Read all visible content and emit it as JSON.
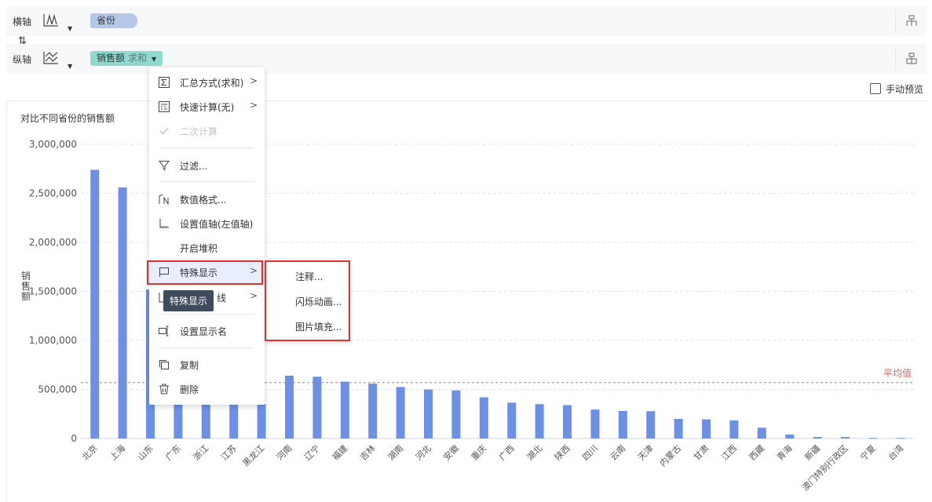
{
  "axes": {
    "x": {
      "label": "横轴",
      "field": "省份"
    },
    "y": {
      "label": "纵轴",
      "field": "销售额",
      "aggregation": "求和"
    }
  },
  "manual_preview": {
    "label": "手动预览"
  },
  "context_menu": {
    "items": [
      {
        "label": "汇总方式(求和)",
        "icon": "sigma-icon",
        "submenu": true
      },
      {
        "label": "快速计算(无)",
        "icon": "calculator-icon",
        "submenu": true
      },
      {
        "label": "二次计算",
        "icon": "check-icon",
        "disabled": true
      },
      {
        "label": "过滤...",
        "icon": "filter-icon"
      },
      {
        "label": "数值格式...",
        "icon": "number-format-icon"
      },
      {
        "label": "设置值轴(左值轴)",
        "icon": "value-axis-icon"
      },
      {
        "label": "开启堆积"
      },
      {
        "label": "特殊显示",
        "icon": "flag-icon",
        "submenu": true,
        "highlighted": true
      },
      {
        "label": "线",
        "icon": "line-icon",
        "submenu": true
      },
      {
        "label": "设置显示名",
        "icon": "rename-icon"
      },
      {
        "label": "复制",
        "icon": "copy-icon"
      },
      {
        "label": "删除",
        "icon": "trash-icon"
      }
    ],
    "tooltip": "特殊显示",
    "submenu": [
      "注释...",
      "闪烁动画...",
      "图片填充..."
    ]
  },
  "chart_data": {
    "type": "bar",
    "title": "对比不同省份的销售额",
    "ylabel": "销售额",
    "xlabel": "",
    "ylim": [
      0,
      3000000
    ],
    "yticks": [
      "3,000,000",
      "2,500,000",
      "2,000,000",
      "1,500,000",
      "1,000,000",
      "500,000",
      "0"
    ],
    "ytick_values": [
      3000000,
      2500000,
      2000000,
      1500000,
      1000000,
      500000,
      0
    ],
    "categories": [
      "北京",
      "上海",
      "山东",
      "广东",
      "浙江",
      "江苏",
      "黑龙江",
      "河南",
      "辽宁",
      "福建",
      "吉林",
      "湖南",
      "河北",
      "安徽",
      "重庆",
      "广西",
      "湖北",
      "陕西",
      "四川",
      "云南",
      "天津",
      "内蒙古",
      "甘肃",
      "江西",
      "西藏",
      "青海",
      "新疆",
      "澳门特别行政区",
      "宁夏",
      "台湾"
    ],
    "values": [
      2740000,
      2560000,
      1520000,
      480000,
      410000,
      380000,
      350000,
      640000,
      630000,
      580000,
      560000,
      525000,
      500000,
      490000,
      420000,
      365000,
      350000,
      340000,
      295000,
      280000,
      278000,
      200000,
      195000,
      185000,
      110000,
      40000,
      15000,
      15000,
      5000,
      5000
    ],
    "reference_line": {
      "label": "平均值",
      "value": 570000,
      "color": "#e06666"
    },
    "bar_color": "#6c8fe8",
    "grid": true
  }
}
